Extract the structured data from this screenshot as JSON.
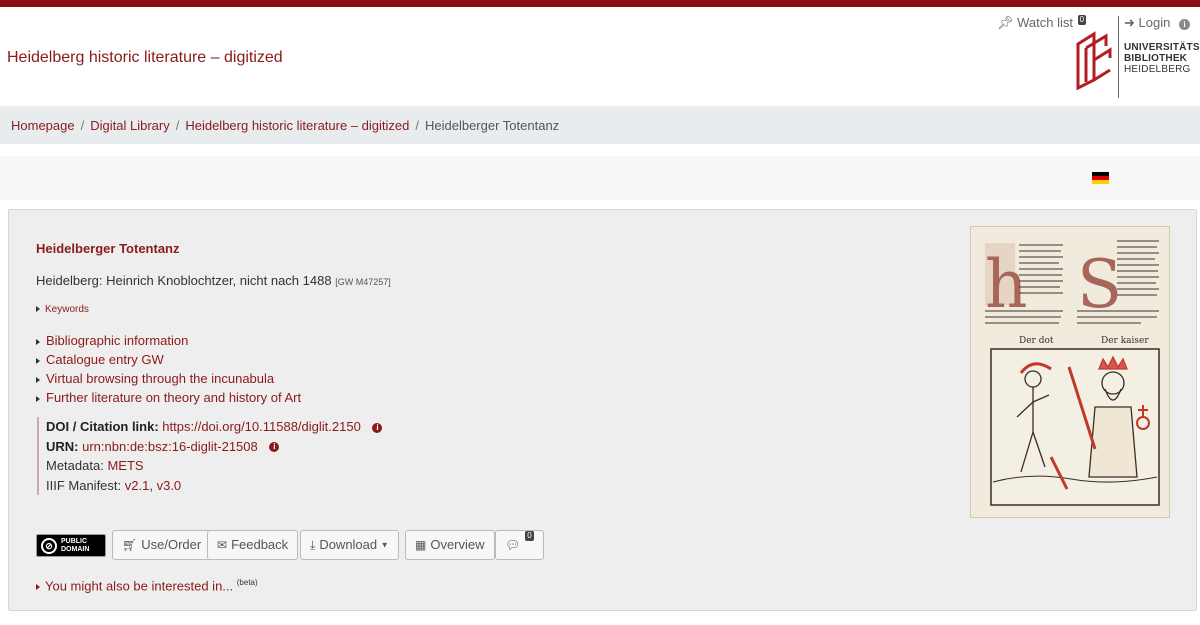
{
  "header": {
    "site_title": "Heidelberg historic literature – digitized",
    "logo_line1": "UNIVERSITÄTS-",
    "logo_line2": "BIBLIOTHEK",
    "logo_line3": "HEIDELBERG"
  },
  "breadcrumb": {
    "items": [
      "Homepage",
      "Digital Library",
      "Heidelberg historic literature – digitized"
    ],
    "current": "Heidelberger Totentanz",
    "separator": "/"
  },
  "toolbar": {
    "watchlist_label": "Watch list",
    "watchlist_count": "0",
    "login_label": "Login"
  },
  "record": {
    "title": "Heidelberger Totentanz",
    "imprint": "Heidelberg: Heinrich Knoblochtzer, nicht nach 1488",
    "gw_ref": "[GW M47257]",
    "keywords_label": "Keywords",
    "links": [
      "Bibliographic information",
      "Catalogue entry GW",
      "Virtual browsing through the incunabula",
      "Further literature on theory and history of Art"
    ],
    "doi_label": "DOI / Citation link:",
    "doi_value": "https://doi.org/10.11588/diglit.2150",
    "urn_label": "URN:",
    "urn_value": "urn:nbn:de:bsz:16-diglit-21508",
    "metadata_label": "Metadata:",
    "metadata_value": "METS",
    "iiif_label": "IIIF Manifest:",
    "iiif_v2": "v2.1",
    "iiif_sep": ",",
    "iiif_v3": "v3.0"
  },
  "license": {
    "line1": "PUBLIC",
    "line2": "DOMAIN"
  },
  "buttons": {
    "use_order": "Use/Order",
    "feedback": "Feedback",
    "download": "Download",
    "overview": "Overview",
    "comments_count": "0"
  },
  "also_interested": {
    "label": "You might also be interested in...",
    "beta": "(beta)"
  },
  "thumbnail": {
    "caption_left": "Der dot",
    "caption_right": "Der kaiser"
  },
  "colors": {
    "accent": "#8b1a1a",
    "topbar": "#8a0f13",
    "breadcrumb_bg": "#e9ecef",
    "panel_bg": "#eeeeee"
  }
}
